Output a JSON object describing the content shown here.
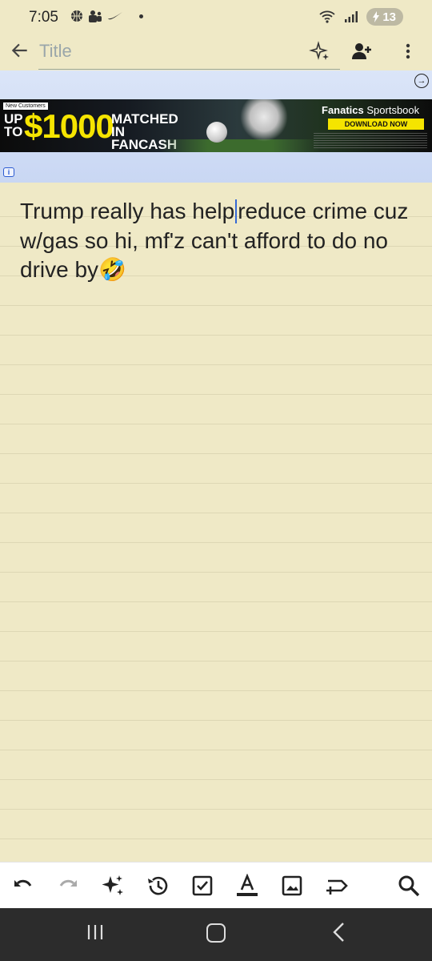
{
  "status_bar": {
    "time": "7:05",
    "battery": "13"
  },
  "app_bar": {
    "title_placeholder": "Title"
  },
  "ad": {
    "badge": "New Customers",
    "headline_prefix": "UP TO",
    "amount": "$1000",
    "headline_suffix": "MATCHED IN FANCASH",
    "brand": "Fanatics",
    "brand_suffix": "Sportsbook",
    "cta": "DOWNLOAD NOW"
  },
  "note": {
    "text_before_cursor": "Trump really has help",
    "text_after_cursor": "reduce crime cuz w/gas so hi, mf'z can't afford to do no drive by🤣"
  },
  "colors": {
    "note_background": "#efe9c6",
    "ad_accent": "#f5e400",
    "cursor": "#3568d4",
    "nav_background": "#2c2c2c"
  },
  "toolbar": {
    "icons": [
      "undo-icon",
      "redo-icon",
      "ai-sparkle-icon",
      "history-icon",
      "checkbox-icon",
      "text-format-icon",
      "image-icon",
      "label-icon",
      "search-icon"
    ]
  }
}
